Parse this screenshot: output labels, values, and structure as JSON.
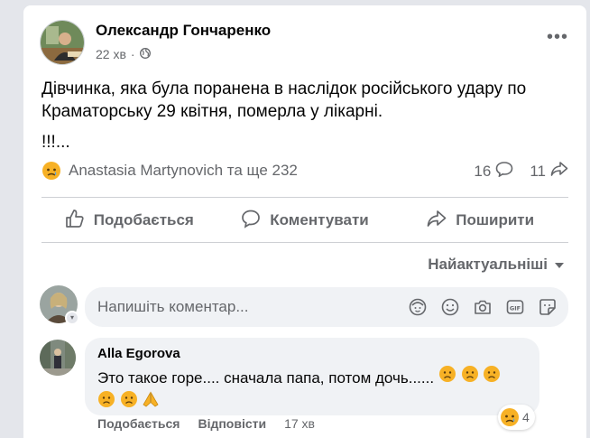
{
  "post": {
    "author": "Олександр Гончаренко",
    "time": "22 хв",
    "privacy_icon": "globe-icon",
    "text": "Дівчинка, яка була поранена в наслідок російського удару по Краматорську 29 квітня, померла у лікарні.",
    "extra": "!!!...",
    "reaction_summary": "Anastasia Martynovich та ще 232",
    "comment_count": "16",
    "share_count": "11"
  },
  "actions": {
    "like": "Подобається",
    "comment": "Коментувати",
    "share": "Поширити"
  },
  "sort_label": "Найактуальніші",
  "composer": {
    "placeholder": "Напишіть коментар..."
  },
  "comment": {
    "author": "Alla Egorova",
    "text": "Это такое горе.... сначала папа, потом дочь......",
    "like": "Подобається",
    "reply": "Відповісти",
    "time": "17 хв",
    "reaction_count": "4"
  },
  "colors": {
    "sad_face": "#f7b125",
    "secondary_text": "#65676b",
    "bubble": "#f0f2f5"
  }
}
